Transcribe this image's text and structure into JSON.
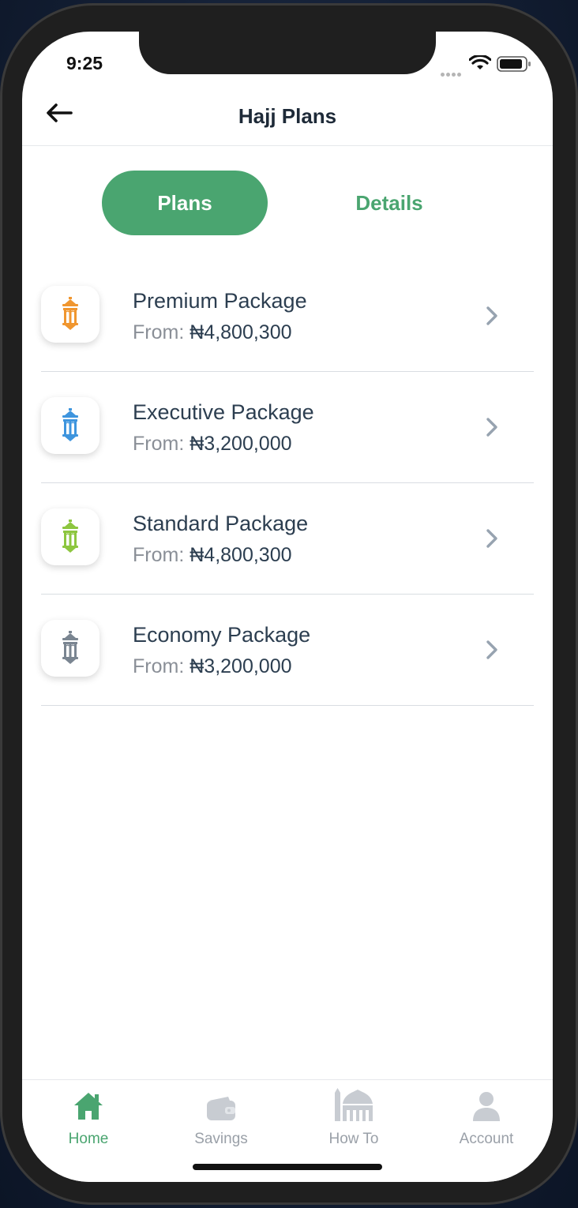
{
  "status_bar": {
    "time": "9:25"
  },
  "nav": {
    "title": "Hajj Plans"
  },
  "segments": {
    "plans": "Plans",
    "details": "Details"
  },
  "price_prefix": "From:",
  "plans": [
    {
      "name": "Premium Package",
      "price": "₦4,800,300",
      "icon": "lantern-icon",
      "color": "#f0962f"
    },
    {
      "name": "Executive Package",
      "price": "₦3,200,000",
      "icon": "lantern-icon",
      "color": "#3e95de"
    },
    {
      "name": "Standard Package",
      "price": "₦4,800,300",
      "icon": "lantern-icon",
      "color": "#8dc63f"
    },
    {
      "name": "Economy Package",
      "price": "₦3,200,000",
      "icon": "lantern-icon",
      "color": "#7a8591"
    }
  ],
  "tabbar": {
    "home": "Home",
    "savings": "Savings",
    "how_to": "How To",
    "account": "Account"
  },
  "colors": {
    "accent": "#4aa570",
    "text_dark": "#2c3e50",
    "muted": "#9aa0a8"
  }
}
